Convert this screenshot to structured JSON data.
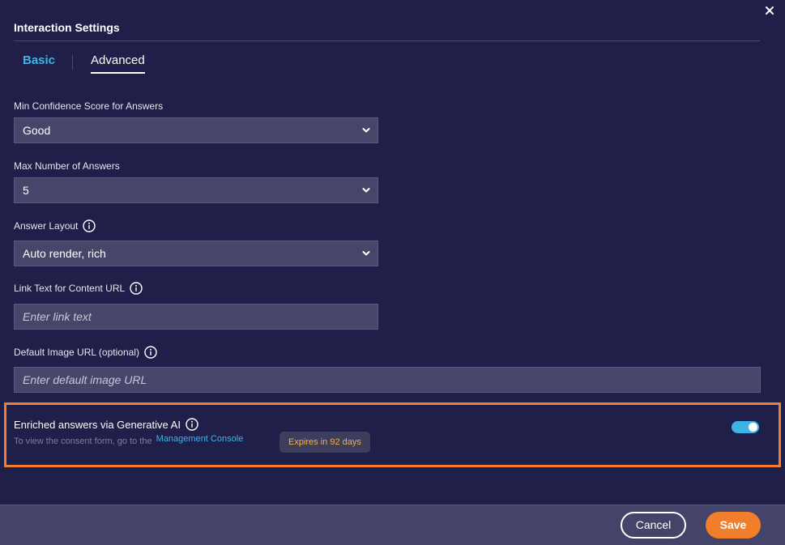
{
  "dialog": {
    "title": "Interaction Settings",
    "close_icon": "close-icon"
  },
  "tabs": [
    {
      "label": "Basic",
      "active": false
    },
    {
      "label": "Advanced",
      "active": true
    }
  ],
  "fields": {
    "min_confidence": {
      "label": "Min Confidence Score for Answers",
      "value": "Good"
    },
    "max_answers": {
      "label": "Max Number of Answers",
      "value": "5"
    },
    "answer_layout": {
      "label": "Answer Layout",
      "value": "Auto render, rich",
      "icon": "info-icon"
    },
    "link_text": {
      "label": "Link Text for Content URL",
      "placeholder": "Enter link text",
      "icon": "info-icon"
    },
    "default_image": {
      "label": "Default Image URL (optional)",
      "placeholder": "Enter default image URL",
      "icon": "info-icon"
    }
  },
  "generative_ai": {
    "title": "Enriched answers via Generative AI",
    "subtitle": "To view the consent form, go to the",
    "link": "Management Console",
    "badge": "Expires in 92 days",
    "enabled": true
  },
  "footer": {
    "cancel_label": "Cancel",
    "save_label": "Save"
  },
  "colors": {
    "background": "#1f1f4a",
    "accent": "#3eb4e6",
    "primary_button": "#f07e2a",
    "badge_text": "#f2b14c"
  }
}
